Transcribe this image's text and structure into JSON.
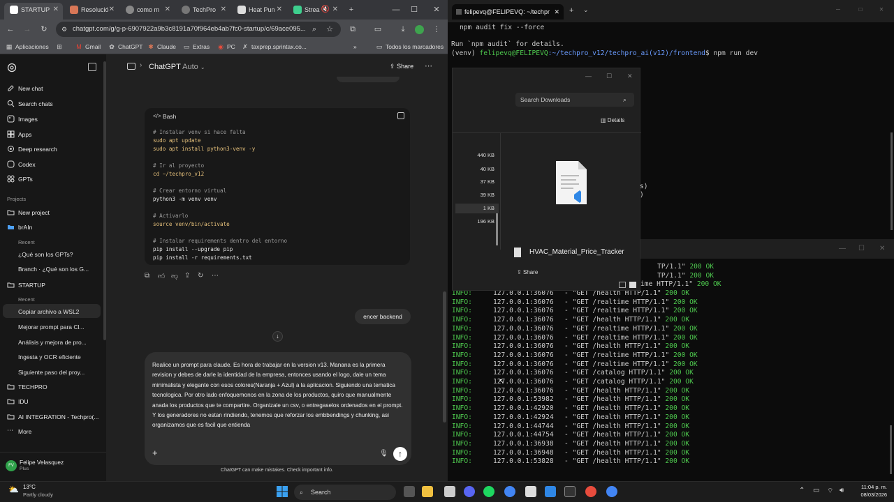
{
  "browser": {
    "tabs": [
      {
        "label": "STARTUP"
      },
      {
        "label": "Resolució"
      },
      {
        "label": "como m"
      },
      {
        "label": "TechPro"
      },
      {
        "label": "Heat Pun"
      },
      {
        "label": "Strea"
      }
    ],
    "url": "chatgpt.com/g/g-p-6907922a9b3c8191a70f964eb4ab7fc0-startup/c/69ace095...",
    "bookmarks": [
      "Aplicaciones",
      "Gmail",
      "ChatGPT",
      "Claude",
      "Extras",
      "PC",
      "taxprep.sprintax.co...",
      "Todos los marcadores"
    ]
  },
  "sidebar": {
    "top_items": [
      "New chat",
      "Search chats",
      "Images",
      "Apps",
      "Deep research",
      "Codex",
      "GPTs"
    ],
    "projects_label": "Projects",
    "new_project": "New project",
    "brain": "brAIn",
    "recent_label": "Recent",
    "brain_recent": [
      "¿Qué son los GPTs?",
      "Branch · ¿Qué son los G..."
    ],
    "startup": "STARTUP",
    "startup_recent_label": "Recent",
    "startup_recent": [
      "Copiar archivo a WSL2",
      "Mejorar prompt para Cl...",
      "Análisis y mejora de pro...",
      "Ingesta y OCR eficiente",
      "Siguiente paso del proy..."
    ],
    "projects_more": [
      "TECHPRO",
      "IDU",
      "AI INTEGRATION - Techpro(..."
    ],
    "more": "More",
    "user_name": "Felipe Velasquez",
    "user_plan": "Plus",
    "user_initials": "FV"
  },
  "header": {
    "title": "ChatGPT",
    "model": "Auto",
    "share": "Share"
  },
  "code": {
    "lang": "Bash",
    "lines": [
      {
        "c": "# Instalar venv si hace falta",
        "t": "cm"
      },
      {
        "c": "sudo apt update",
        "t": "kw"
      },
      {
        "c": "sudo apt install python3-venv -y",
        "t": "kw"
      },
      {
        "c": "",
        "t": "tx"
      },
      {
        "c": "# Ir al proyecto",
        "t": "cm"
      },
      {
        "c": "cd ~/techpro_v12",
        "t": "kw"
      },
      {
        "c": "",
        "t": "tx"
      },
      {
        "c": "# Crear entorno virtual",
        "t": "cm"
      },
      {
        "c": "python3 -m venv venv",
        "t": "tx"
      },
      {
        "c": "",
        "t": "tx"
      },
      {
        "c": "# Activarlo",
        "t": "cm"
      },
      {
        "c": "source venv/bin/activate",
        "t": "kw"
      },
      {
        "c": "",
        "t": "tx"
      },
      {
        "c": "# Instalar requirements dentro del entorno",
        "t": "cm"
      },
      {
        "c": "pip install --upgrade pip",
        "t": "tx"
      },
      {
        "c": "pip install -r requirements.txt",
        "t": "tx"
      }
    ]
  },
  "user_message": "encer backend",
  "composer": {
    "text": "Realice un prompt para claude. Es hora de trabajar en la version v13. Manana es la primera revision y debes de darle la identidad de la empresa, entonces usando el logo, dale un tema minimalista y elegante con esos colores(Naranja + Azul) a la aplicacion. Siguiendo una tematica tecnologica. Por otro lado enfoquemonos en la zona de los productos, quiro que manualmente anada los productos que te compartire. Organizale un csv, o entregaselos ordenados en el prompt. Y los generadores no estan rindiendo, tenemos que reforzar los embbendings y chunking, asi organizamos que es facil que entienda"
  },
  "footnote": "ChatGPT can make mistakes. Check important info.",
  "terminal": {
    "tab_title": "felipevq@FELIPEVQ: ~/techpr",
    "line1": "npm audit fix --force",
    "line2": "Run `npm audit` for details.",
    "prompt_env": "(venv)",
    "prompt_user": "felipevq@FELIPEVQ",
    "prompt_path": ":~/techpro_v12/techpro_ai(v12)/frontend",
    "prompt_cmd": "$ npm run dev",
    "side_fragments": [
      "s)",
      ")"
    ],
    "top_partial": [
      {
        "req": "TP/1.1\"",
        "status": "200 OK"
      },
      {
        "req": "TP/1.1\"",
        "status": "200 OK"
      },
      {
        "req": "ime HTTP/1.1\"",
        "status": "200 OK"
      }
    ],
    "log_lines": [
      {
        "level": "INFO:",
        "addr": "127.0.0.1:36076",
        "req": "- \"GET /health HTTP/1.1\"",
        "status": "200 OK"
      },
      {
        "level": "INFO:",
        "addr": "127.0.0.1:36076",
        "req": "- \"GET /realtime HTTP/1.1\"",
        "status": "200 OK"
      },
      {
        "level": "INFO:",
        "addr": "127.0.0.1:36076",
        "req": "- \"GET /realtime HTTP/1.1\"",
        "status": "200 OK"
      },
      {
        "level": "INFO:",
        "addr": "127.0.0.1:36076",
        "req": "- \"GET /health HTTP/1.1\"",
        "status": "200 OK"
      },
      {
        "level": "INFO:",
        "addr": "127.0.0.1:36076",
        "req": "- \"GET /realtime HTTP/1.1\"",
        "status": "200 OK"
      },
      {
        "level": "INFO:",
        "addr": "127.0.0.1:36076",
        "req": "- \"GET /realtime HTTP/1.1\"",
        "status": "200 OK"
      },
      {
        "level": "INFO:",
        "addr": "127.0.0.1:36076",
        "req": "- \"GET /health HTTP/1.1\"",
        "status": "200 OK"
      },
      {
        "level": "INFO:",
        "addr": "127.0.0.1:36076",
        "req": "- \"GET /realtime HTTP/1.1\"",
        "status": "200 OK"
      },
      {
        "level": "INFO:",
        "addr": "127.0.0.1:36076",
        "req": "- \"GET /realtime HTTP/1.1\"",
        "status": "200 OK"
      },
      {
        "level": "INFO:",
        "addr": "127.0.0.1:36076",
        "req": "- \"GET /catalog HTTP/1.1\"",
        "status": "200 OK"
      },
      {
        "level": "INFO:",
        "addr": "127.0.0.1:36076",
        "req": "- \"GET /catalog HTTP/1.1\"",
        "status": "200 OK"
      },
      {
        "level": "INFO:",
        "addr": "127.0.0.1:36076",
        "req": "- \"GET /health HTTP/1.1\"",
        "status": "200 OK"
      },
      {
        "level": "INFO:",
        "addr": "127.0.0.1:53982",
        "req": "- \"GET /health HTTP/1.1\"",
        "status": "200 OK"
      },
      {
        "level": "INFO:",
        "addr": "127.0.0.1:42920",
        "req": "- \"GET /health HTTP/1.1\"",
        "status": "200 OK"
      },
      {
        "level": "INFO:",
        "addr": "127.0.0.1:42924",
        "req": "- \"GET /health HTTP/1.1\"",
        "status": "200 OK"
      },
      {
        "level": "INFO:",
        "addr": "127.0.0.1:44744",
        "req": "- \"GET /health HTTP/1.1\"",
        "status": "200 OK"
      },
      {
        "level": "INFO:",
        "addr": "127.0.0.1:44754",
        "req": "- \"GET /health HTTP/1.1\"",
        "status": "200 OK"
      },
      {
        "level": "INFO:",
        "addr": "127.0.0.1:36938",
        "req": "- \"GET /health HTTP/1.1\"",
        "status": "200 OK"
      },
      {
        "level": "INFO:",
        "addr": "127.0.0.1:36948",
        "req": "- \"GET /health HTTP/1.1\"",
        "status": "200 OK"
      },
      {
        "level": "INFO:",
        "addr": "127.0.0.1:53828",
        "req": "- \"GET /health HTTP/1.1\"",
        "status": "200 OK"
      }
    ]
  },
  "explorer": {
    "search_placeholder": "Search Downloads",
    "details": "Details",
    "sizes": [
      "440 KB",
      "40 KB",
      "37 KB",
      "39 KB",
      "1 KB",
      "196 KB"
    ],
    "file_name": "HVAC_Material_Price_Tracker",
    "share": "Share"
  },
  "taskbar": {
    "temp": "13°C",
    "weather": "Partly cloudy",
    "search": "Search",
    "time": "11:04 p. m.",
    "date": "08/03/2026"
  },
  "colors": {
    "terminal_green": "#4ec94e",
    "prompt_blue": "#6b9cff",
    "accent_send": "#ffffff"
  }
}
